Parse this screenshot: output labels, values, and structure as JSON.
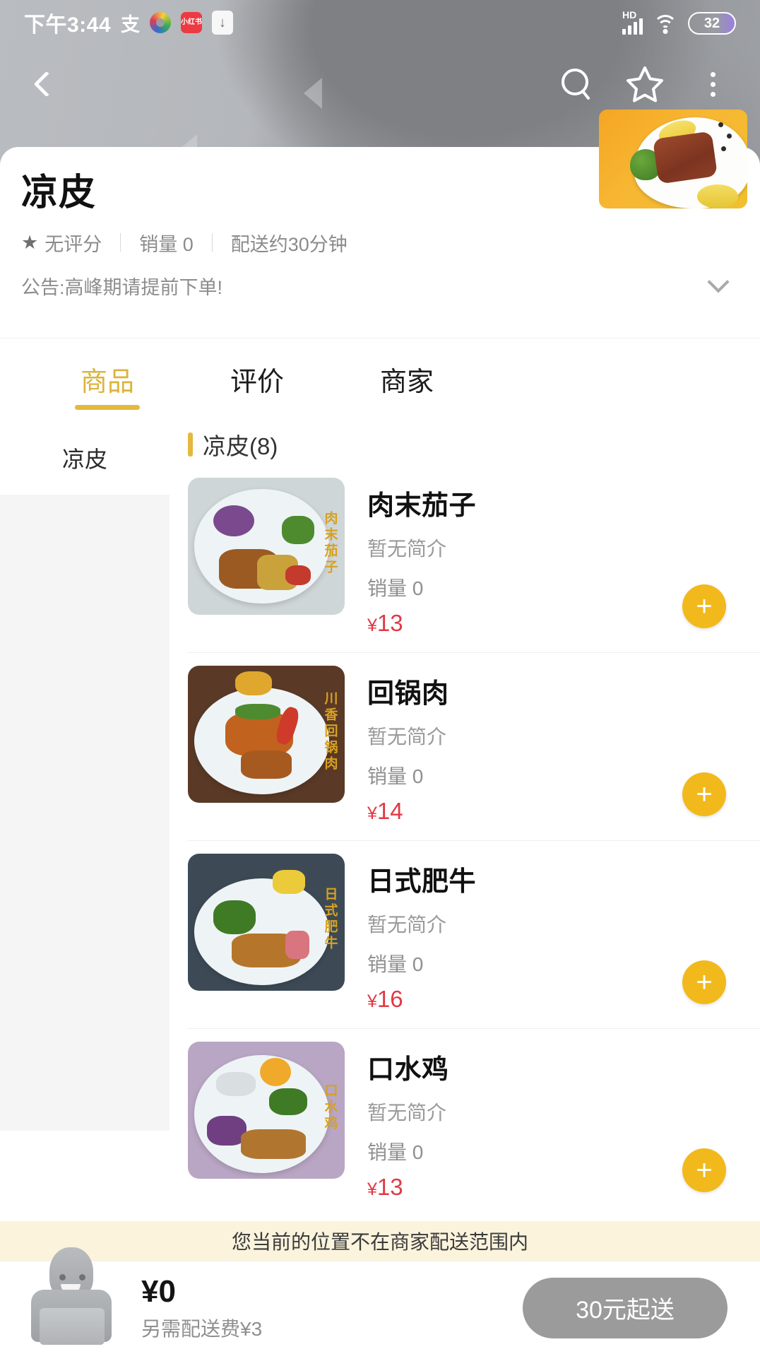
{
  "status_bar": {
    "time": "下午3:44",
    "alipay_label": "支",
    "xiaohongshu_label": "小红书",
    "download_icon": "download-icon",
    "hd_label": "HD",
    "battery_level": "32",
    "wifi_icon": "wifi-icon",
    "signal_icon": "signal-bars-icon"
  },
  "navbar": {
    "back_icon": "back-chevron-icon",
    "search_icon": "search-icon",
    "favorite_icon": "star-icon",
    "menu_icon": "more-vertical-icon"
  },
  "store": {
    "name": "凉皮",
    "logo_alt": "store-logo",
    "rating_text": "无评分",
    "rating_star_icon": "star-filled-icon",
    "sales_text": "销量 0",
    "delivery_time_text": "配送约30分钟",
    "notice": "公告:高峰期请提前下单!",
    "notice_expand_icon": "chevron-down-icon"
  },
  "tabs": [
    {
      "label": "商品",
      "active": true
    },
    {
      "label": "评价",
      "active": false
    },
    {
      "label": "商家",
      "active": false
    }
  ],
  "sidebar": {
    "categories": [
      {
        "label": "凉皮",
        "active": true
      }
    ]
  },
  "menu": {
    "section_title": "凉皮(8)",
    "items": [
      {
        "name": "肉末茄子",
        "desc": "暂无简介",
        "sales": "销量 0",
        "currency": "¥",
        "price": "13",
        "add_icon": "plus-icon",
        "photo_label": "肉末茄子"
      },
      {
        "name": "回锅肉",
        "desc": "暂无简介",
        "sales": "销量 0",
        "currency": "¥",
        "price": "14",
        "add_icon": "plus-icon",
        "photo_label": "川香回锅肉"
      },
      {
        "name": "日式肥牛",
        "desc": "暂无简介",
        "sales": "销量 0",
        "currency": "¥",
        "price": "16",
        "add_icon": "plus-icon",
        "photo_label": "日式肥牛"
      },
      {
        "name": "口水鸡",
        "desc": "暂无简介",
        "sales": "销量 0",
        "currency": "¥",
        "price": "13",
        "add_icon": "plus-icon",
        "photo_label": "口水鸡"
      }
    ]
  },
  "warning": {
    "text": "您当前的位置不在商家配送范围内"
  },
  "cart": {
    "icon": "delivery-person-icon",
    "total": "¥0",
    "delivery_fee_text": "另需配送费¥3",
    "checkout_label": "30元起送"
  },
  "colors": {
    "accent": "#e3b93e",
    "price": "#e03a46",
    "add_button": "#f2b91c",
    "warning_bg": "#fbf3dc",
    "checkout_disabled": "#9b9b9b"
  }
}
